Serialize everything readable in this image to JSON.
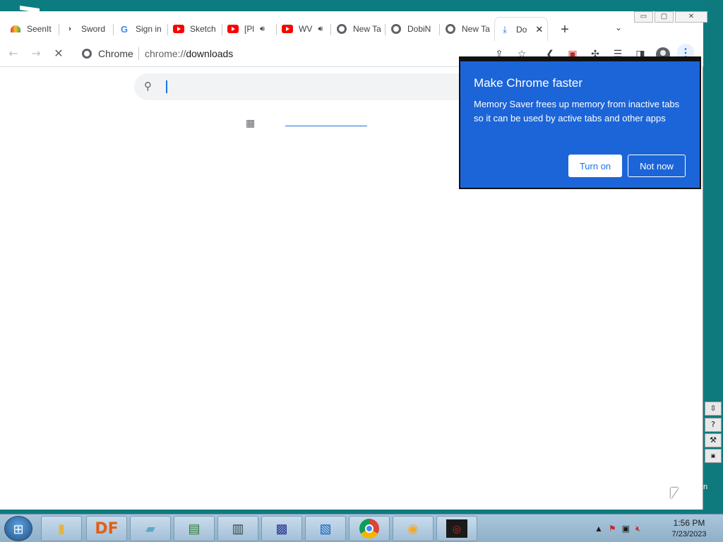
{
  "window_controls": {
    "minimize": "▭",
    "maximize": "▢",
    "close": "✕"
  },
  "tabs": [
    {
      "label": "SeenIt",
      "icon": "seenit-icon"
    },
    {
      "label": "Sword",
      "icon": "sword-icon"
    },
    {
      "label": "Sign in",
      "icon": "google-icon"
    },
    {
      "label": "Sketch",
      "icon": "youtube-icon"
    },
    {
      "label": "[Pl",
      "icon": "youtube-icon",
      "audio": true
    },
    {
      "label": "WV",
      "icon": "youtube-icon",
      "audio": true
    },
    {
      "label": "New Ta",
      "icon": "chrome-icon"
    },
    {
      "label": "DobiN",
      "icon": "globe-icon"
    },
    {
      "label": "New Ta",
      "icon": "chrome-icon"
    },
    {
      "label": "Do",
      "icon": "download-icon",
      "active": true
    }
  ],
  "toolbar": {
    "site_label": "Chrome",
    "url_scheme": "chrome://",
    "url_path": "downloads"
  },
  "promo": {
    "title": "Make Chrome faster",
    "body": "Memory Saver frees up memory from inactive tabs so it can be used by active tabs and other apps",
    "primary_button": "Turn on",
    "secondary_button": "Not now"
  },
  "desktop": {
    "label": "n"
  },
  "taskbar": {
    "apps": [
      {
        "name": "explorer",
        "icon": "folder-icon"
      },
      {
        "name": "df",
        "label": "DF"
      },
      {
        "name": "notepad",
        "icon": "notepad-icon"
      },
      {
        "name": "task-monitor",
        "icon": "monitor-icon"
      },
      {
        "name": "document",
        "icon": "document-icon"
      },
      {
        "name": "installer",
        "icon": "installer-icon"
      },
      {
        "name": "wordpad",
        "icon": "wordpad-icon"
      },
      {
        "name": "chrome",
        "icon": "chrome-icon"
      },
      {
        "name": "disc",
        "icon": "disc-icon"
      },
      {
        "name": "game",
        "icon": "game-icon"
      }
    ],
    "clock_time": "1:56 PM",
    "clock_date": "7/23/2023"
  },
  "colors": {
    "accent": "#1a73e8",
    "promo_bg": "#1c65d8",
    "desktop": "#0d7c80"
  }
}
